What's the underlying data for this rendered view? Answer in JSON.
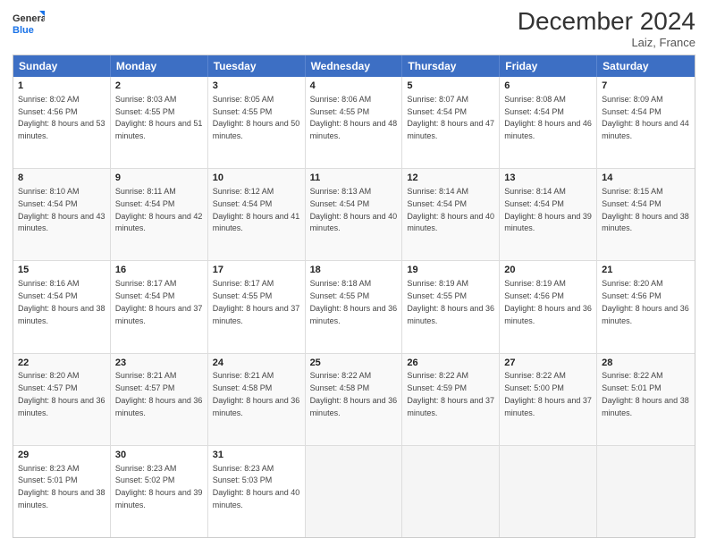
{
  "header": {
    "logo_line1": "General",
    "logo_line2": "Blue",
    "month": "December 2024",
    "location": "Laiz, France"
  },
  "weekdays": [
    "Sunday",
    "Monday",
    "Tuesday",
    "Wednesday",
    "Thursday",
    "Friday",
    "Saturday"
  ],
  "weeks": [
    [
      {
        "day": "1",
        "rise": "Sunrise: 8:02 AM",
        "set": "Sunset: 4:56 PM",
        "daylight": "Daylight: 8 hours and 53 minutes."
      },
      {
        "day": "2",
        "rise": "Sunrise: 8:03 AM",
        "set": "Sunset: 4:55 PM",
        "daylight": "Daylight: 8 hours and 51 minutes."
      },
      {
        "day": "3",
        "rise": "Sunrise: 8:05 AM",
        "set": "Sunset: 4:55 PM",
        "daylight": "Daylight: 8 hours and 50 minutes."
      },
      {
        "day": "4",
        "rise": "Sunrise: 8:06 AM",
        "set": "Sunset: 4:55 PM",
        "daylight": "Daylight: 8 hours and 48 minutes."
      },
      {
        "day": "5",
        "rise": "Sunrise: 8:07 AM",
        "set": "Sunset: 4:54 PM",
        "daylight": "Daylight: 8 hours and 47 minutes."
      },
      {
        "day": "6",
        "rise": "Sunrise: 8:08 AM",
        "set": "Sunset: 4:54 PM",
        "daylight": "Daylight: 8 hours and 46 minutes."
      },
      {
        "day": "7",
        "rise": "Sunrise: 8:09 AM",
        "set": "Sunset: 4:54 PM",
        "daylight": "Daylight: 8 hours and 44 minutes."
      }
    ],
    [
      {
        "day": "8",
        "rise": "Sunrise: 8:10 AM",
        "set": "Sunset: 4:54 PM",
        "daylight": "Daylight: 8 hours and 43 minutes."
      },
      {
        "day": "9",
        "rise": "Sunrise: 8:11 AM",
        "set": "Sunset: 4:54 PM",
        "daylight": "Daylight: 8 hours and 42 minutes."
      },
      {
        "day": "10",
        "rise": "Sunrise: 8:12 AM",
        "set": "Sunset: 4:54 PM",
        "daylight": "Daylight: 8 hours and 41 minutes."
      },
      {
        "day": "11",
        "rise": "Sunrise: 8:13 AM",
        "set": "Sunset: 4:54 PM",
        "daylight": "Daylight: 8 hours and 40 minutes."
      },
      {
        "day": "12",
        "rise": "Sunrise: 8:14 AM",
        "set": "Sunset: 4:54 PM",
        "daylight": "Daylight: 8 hours and 40 minutes."
      },
      {
        "day": "13",
        "rise": "Sunrise: 8:14 AM",
        "set": "Sunset: 4:54 PM",
        "daylight": "Daylight: 8 hours and 39 minutes."
      },
      {
        "day": "14",
        "rise": "Sunrise: 8:15 AM",
        "set": "Sunset: 4:54 PM",
        "daylight": "Daylight: 8 hours and 38 minutes."
      }
    ],
    [
      {
        "day": "15",
        "rise": "Sunrise: 8:16 AM",
        "set": "Sunset: 4:54 PM",
        "daylight": "Daylight: 8 hours and 38 minutes."
      },
      {
        "day": "16",
        "rise": "Sunrise: 8:17 AM",
        "set": "Sunset: 4:54 PM",
        "daylight": "Daylight: 8 hours and 37 minutes."
      },
      {
        "day": "17",
        "rise": "Sunrise: 8:17 AM",
        "set": "Sunset: 4:55 PM",
        "daylight": "Daylight: 8 hours and 37 minutes."
      },
      {
        "day": "18",
        "rise": "Sunrise: 8:18 AM",
        "set": "Sunset: 4:55 PM",
        "daylight": "Daylight: 8 hours and 36 minutes."
      },
      {
        "day": "19",
        "rise": "Sunrise: 8:19 AM",
        "set": "Sunset: 4:55 PM",
        "daylight": "Daylight: 8 hours and 36 minutes."
      },
      {
        "day": "20",
        "rise": "Sunrise: 8:19 AM",
        "set": "Sunset: 4:56 PM",
        "daylight": "Daylight: 8 hours and 36 minutes."
      },
      {
        "day": "21",
        "rise": "Sunrise: 8:20 AM",
        "set": "Sunset: 4:56 PM",
        "daylight": "Daylight: 8 hours and 36 minutes."
      }
    ],
    [
      {
        "day": "22",
        "rise": "Sunrise: 8:20 AM",
        "set": "Sunset: 4:57 PM",
        "daylight": "Daylight: 8 hours and 36 minutes."
      },
      {
        "day": "23",
        "rise": "Sunrise: 8:21 AM",
        "set": "Sunset: 4:57 PM",
        "daylight": "Daylight: 8 hours and 36 minutes."
      },
      {
        "day": "24",
        "rise": "Sunrise: 8:21 AM",
        "set": "Sunset: 4:58 PM",
        "daylight": "Daylight: 8 hours and 36 minutes."
      },
      {
        "day": "25",
        "rise": "Sunrise: 8:22 AM",
        "set": "Sunset: 4:58 PM",
        "daylight": "Daylight: 8 hours and 36 minutes."
      },
      {
        "day": "26",
        "rise": "Sunrise: 8:22 AM",
        "set": "Sunset: 4:59 PM",
        "daylight": "Daylight: 8 hours and 37 minutes."
      },
      {
        "day": "27",
        "rise": "Sunrise: 8:22 AM",
        "set": "Sunset: 5:00 PM",
        "daylight": "Daylight: 8 hours and 37 minutes."
      },
      {
        "day": "28",
        "rise": "Sunrise: 8:22 AM",
        "set": "Sunset: 5:01 PM",
        "daylight": "Daylight: 8 hours and 38 minutes."
      }
    ],
    [
      {
        "day": "29",
        "rise": "Sunrise: 8:23 AM",
        "set": "Sunset: 5:01 PM",
        "daylight": "Daylight: 8 hours and 38 minutes."
      },
      {
        "day": "30",
        "rise": "Sunrise: 8:23 AM",
        "set": "Sunset: 5:02 PM",
        "daylight": "Daylight: 8 hours and 39 minutes."
      },
      {
        "day": "31",
        "rise": "Sunrise: 8:23 AM",
        "set": "Sunset: 5:03 PM",
        "daylight": "Daylight: 8 hours and 40 minutes."
      },
      {
        "day": "",
        "rise": "",
        "set": "",
        "daylight": ""
      },
      {
        "day": "",
        "rise": "",
        "set": "",
        "daylight": ""
      },
      {
        "day": "",
        "rise": "",
        "set": "",
        "daylight": ""
      },
      {
        "day": "",
        "rise": "",
        "set": "",
        "daylight": ""
      }
    ]
  ]
}
